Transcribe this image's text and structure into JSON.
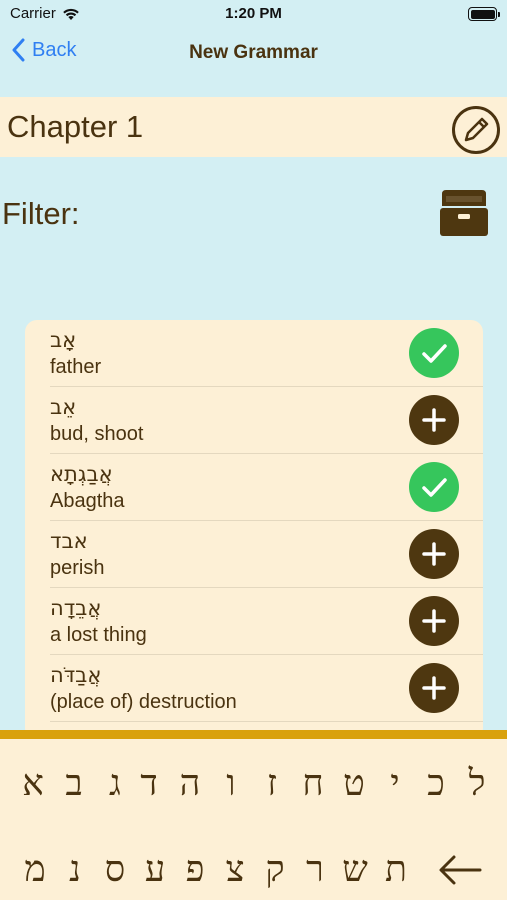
{
  "status": {
    "carrier": "Carrier",
    "time": "1:20 PM"
  },
  "nav": {
    "back_label": "Back",
    "title": "New Grammar"
  },
  "chapter": {
    "title": "Chapter 1"
  },
  "filter": {
    "label": "Filter:"
  },
  "words": [
    {
      "hebrew": "אָב",
      "english": "father",
      "status": "added"
    },
    {
      "hebrew": "אֵב",
      "english": "bud, shoot",
      "status": "add"
    },
    {
      "hebrew": "אֲבַגְתָא",
      "english": "Abagtha",
      "status": "added"
    },
    {
      "hebrew": "אבד",
      "english": "perish",
      "status": "add"
    },
    {
      "hebrew": "אֲבֵדָה",
      "english": "a lost thing",
      "status": "add"
    },
    {
      "hebrew": "אֲבַדֹּה",
      "english": "(place of) destruction",
      "status": "add"
    }
  ],
  "keyboard": {
    "row1": [
      "ל",
      "כ",
      "י",
      "ט",
      "ח",
      "ז",
      "ו",
      "ה",
      "ד",
      "ג",
      "ב",
      "א"
    ],
    "row2": [
      "ת",
      "ש",
      "ר",
      "ק",
      "צ",
      "פ",
      "ע",
      "ס",
      "נ",
      "מ"
    ]
  },
  "colors": {
    "background": "#d3eff3",
    "panel": "#fdf0d6",
    "brown": "#4a3310",
    "green": "#36c65c",
    "accent": "#d9a10d",
    "link": "#2f7ff2"
  }
}
